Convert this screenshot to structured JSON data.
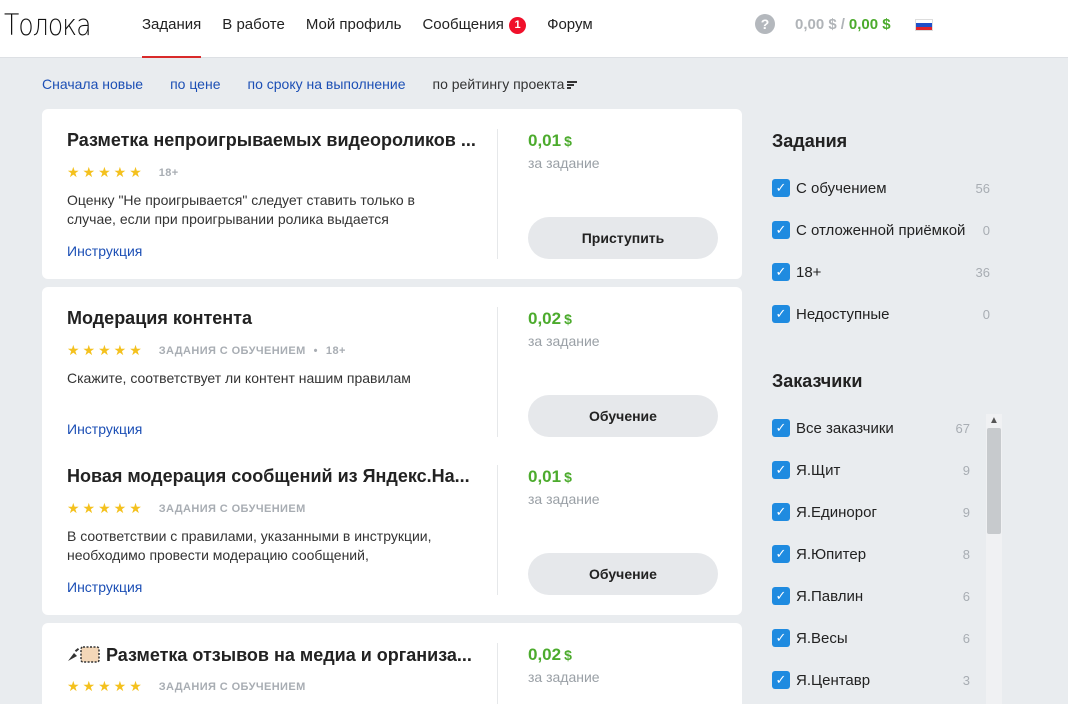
{
  "header": {
    "logo": "Толока",
    "nav": [
      {
        "label": "Задания",
        "active": true
      },
      {
        "label": "В работе"
      },
      {
        "label": "Мой профиль"
      },
      {
        "label": "Сообщения",
        "badge": "1"
      },
      {
        "label": "Форум"
      }
    ],
    "help": "?",
    "balance_pending": "0,00 $",
    "balance_sep": "/",
    "balance_available": "0,00 $",
    "language_flag": "russia-flag-icon"
  },
  "sort": {
    "options": [
      "Сначала новые",
      "по цене",
      "по сроку на выполнение"
    ],
    "active": "по рейтингу проекта"
  },
  "tasks": [
    {
      "title": "Разметка непроигрываемых видеороликов ...",
      "stars": "★★★★★",
      "tags": [
        "18+"
      ],
      "description": "Оценку \"Не проигрывается\" следует ставить только в случае, если при проигрывании ролика выдается",
      "instruction": "Инструкция",
      "price": "0,01",
      "currency": "$",
      "price_unit": "за задание",
      "button": "Приступить"
    },
    {
      "title": "Модерация контента",
      "stars": "★★★★★",
      "tags": [
        "ЗАДАНИЯ С ОБУЧЕНИЕМ",
        "18+"
      ],
      "description": "Скажите, соответствует ли контент нашим правилам",
      "instruction": "Инструкция",
      "price": "0,02",
      "currency": "$",
      "price_unit": "за задание",
      "button": "Обучение"
    },
    {
      "title": "Новая модерация сообщений из Яндекс.На...",
      "stars": "★★★★★",
      "tags": [
        "ЗАДАНИЯ С ОБУЧЕНИЕМ"
      ],
      "description": "В соответствии с правилами, указанными в инструкции, необходимо провести модерацию сообщений,",
      "instruction": "Инструкция",
      "price": "0,01",
      "currency": "$",
      "price_unit": "за задание",
      "button": "Обучение"
    },
    {
      "title": "Разметка отзывов на медиа и организа...",
      "stars": "★★★★★",
      "tags": [
        "ЗАДАНИЯ С ОБУЧЕНИЕМ"
      ],
      "description": "",
      "instruction": "",
      "price": "0,02",
      "currency": "$",
      "price_unit": "за задание",
      "button": ""
    }
  ],
  "sidebar": {
    "tasks_title": "Задания",
    "task_filters": [
      {
        "label": "С обучением",
        "count": "56",
        "checked": true
      },
      {
        "label": "С отложенной приёмкой",
        "count": "0",
        "checked": true
      },
      {
        "label": "18+",
        "count": "36",
        "checked": true
      },
      {
        "label": "Недоступные",
        "count": "0",
        "checked": true
      }
    ],
    "requesters_title": "Заказчики",
    "requesters": [
      {
        "label": "Все заказчики",
        "count": "67",
        "checked": true
      },
      {
        "label": "Я.Щит",
        "count": "9",
        "checked": true
      },
      {
        "label": "Я.Единорог",
        "count": "9",
        "checked": true
      },
      {
        "label": "Я.Юпитер",
        "count": "8",
        "checked": true
      },
      {
        "label": "Я.Павлин",
        "count": "6",
        "checked": true
      },
      {
        "label": "Я.Весы",
        "count": "6",
        "checked": true
      },
      {
        "label": "Я.Центавр",
        "count": "3",
        "checked": true
      }
    ]
  },
  "colors": {
    "accent_red": "#d92a2a",
    "link_blue": "#1c4fb5",
    "price_green": "#4cab2d",
    "checkbox_blue": "#1f8be0",
    "star_yellow": "#f4c11e"
  }
}
